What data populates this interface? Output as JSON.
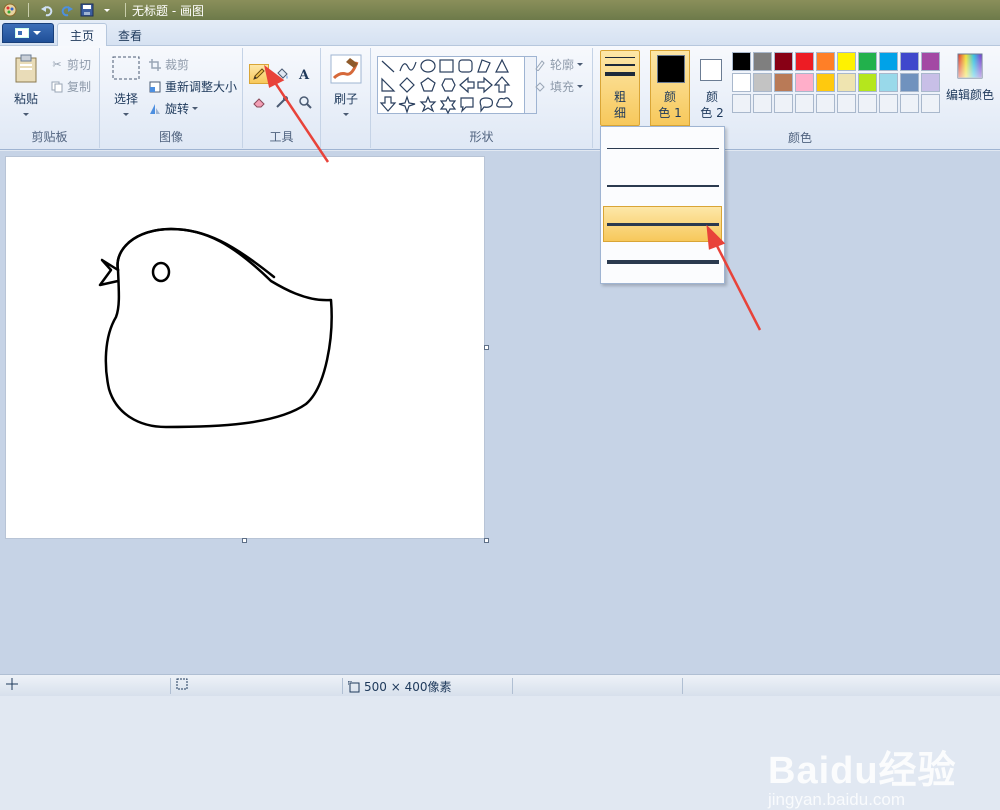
{
  "title_bar": {
    "title": "无标题 - 画图"
  },
  "tabs": {
    "home": "主页",
    "view": "查看"
  },
  "clipboard": {
    "paste": "粘贴",
    "cut": "剪切",
    "copy": "复制",
    "label": "剪贴板"
  },
  "image": {
    "select": "选择",
    "crop": "裁剪",
    "resize": "重新调整大小",
    "rotate": "旋转",
    "label": "图像"
  },
  "tools": {
    "label": "工具",
    "active": "pencil"
  },
  "brushes": {
    "label": "刷子"
  },
  "shapes": {
    "label": "形状",
    "outline": "轮廓",
    "fill": "填充"
  },
  "size": {
    "label_line1": "粗",
    "label_line2": "细"
  },
  "colors": {
    "color1_line1": "颜",
    "color1_line2": "色 1",
    "color2_line1": "颜",
    "color2_line2": "色 2",
    "edit": "编辑颜色",
    "label": "颜色",
    "color1": "#000000",
    "color2": "#ffffff",
    "palette_row1": [
      "#000000",
      "#7f7f7f",
      "#880015",
      "#ed1c24",
      "#ff7f27",
      "#fff200",
      "#22b14c",
      "#00a2e8",
      "#3f48cc",
      "#a349a4"
    ],
    "palette_row2": [
      "#ffffff",
      "#c3c3c3",
      "#b97a57",
      "#ffaec9",
      "#ffc90e",
      "#efe4b0",
      "#b5e61d",
      "#99d9ea",
      "#7092be",
      "#c8bfe7"
    ]
  },
  "size_dropdown": {
    "selected_index": 2,
    "option_count": 4
  },
  "status": {
    "canvas_size": "500 × 400像素"
  },
  "watermark": {
    "brand": "Baidu经验",
    "url": "jingyan.baidu.com"
  }
}
